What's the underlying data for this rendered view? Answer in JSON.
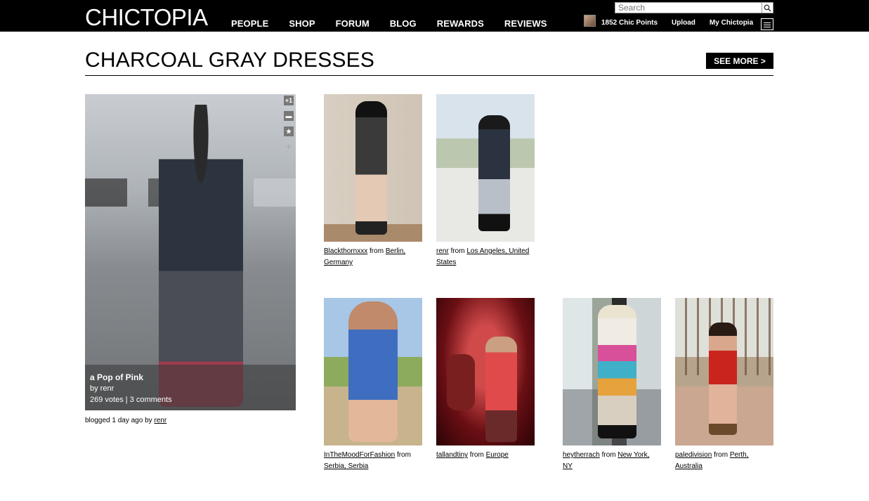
{
  "header": {
    "logo": "CHICTOPIA",
    "nav": [
      "PEOPLE",
      "SHOP",
      "FORUM",
      "BLOG",
      "REWARDS",
      "REVIEWS"
    ],
    "search_placeholder": "Search",
    "chic_points": "1852 Chic Points",
    "upload": "Upload",
    "my_chictopia": "My Chictopia"
  },
  "page": {
    "title": "CHARCOAL GRAY DRESSES",
    "see_more": "SEE MORE  >"
  },
  "featured": {
    "title": "a Pop of Pink",
    "by": "by renr",
    "stats": "269 votes | 3 comments",
    "icons": [
      "+1",
      "comment-icon",
      "star-icon",
      "plus-icon"
    ],
    "blogged_prefix": "blogged 1 day ago by ",
    "blogged_user": "renr"
  },
  "thumbs": [
    {
      "user": "Blackthornxxx",
      "from": " from ",
      "loc": "Berlin, Germany"
    },
    {
      "user": "renr",
      "from": " from ",
      "loc": "Los Angeles, United States"
    },
    {
      "user": "InTheMoodForFashion",
      "from": " from ",
      "loc": "Serbia, Serbia"
    },
    {
      "user": "tallandtiny",
      "from": " from ",
      "loc": "Europe"
    },
    {
      "user": "heytherrach",
      "from": " from ",
      "loc": "New York, NY"
    },
    {
      "user": "paledivision",
      "from": " from ",
      "loc": "Perth, Australia"
    }
  ]
}
